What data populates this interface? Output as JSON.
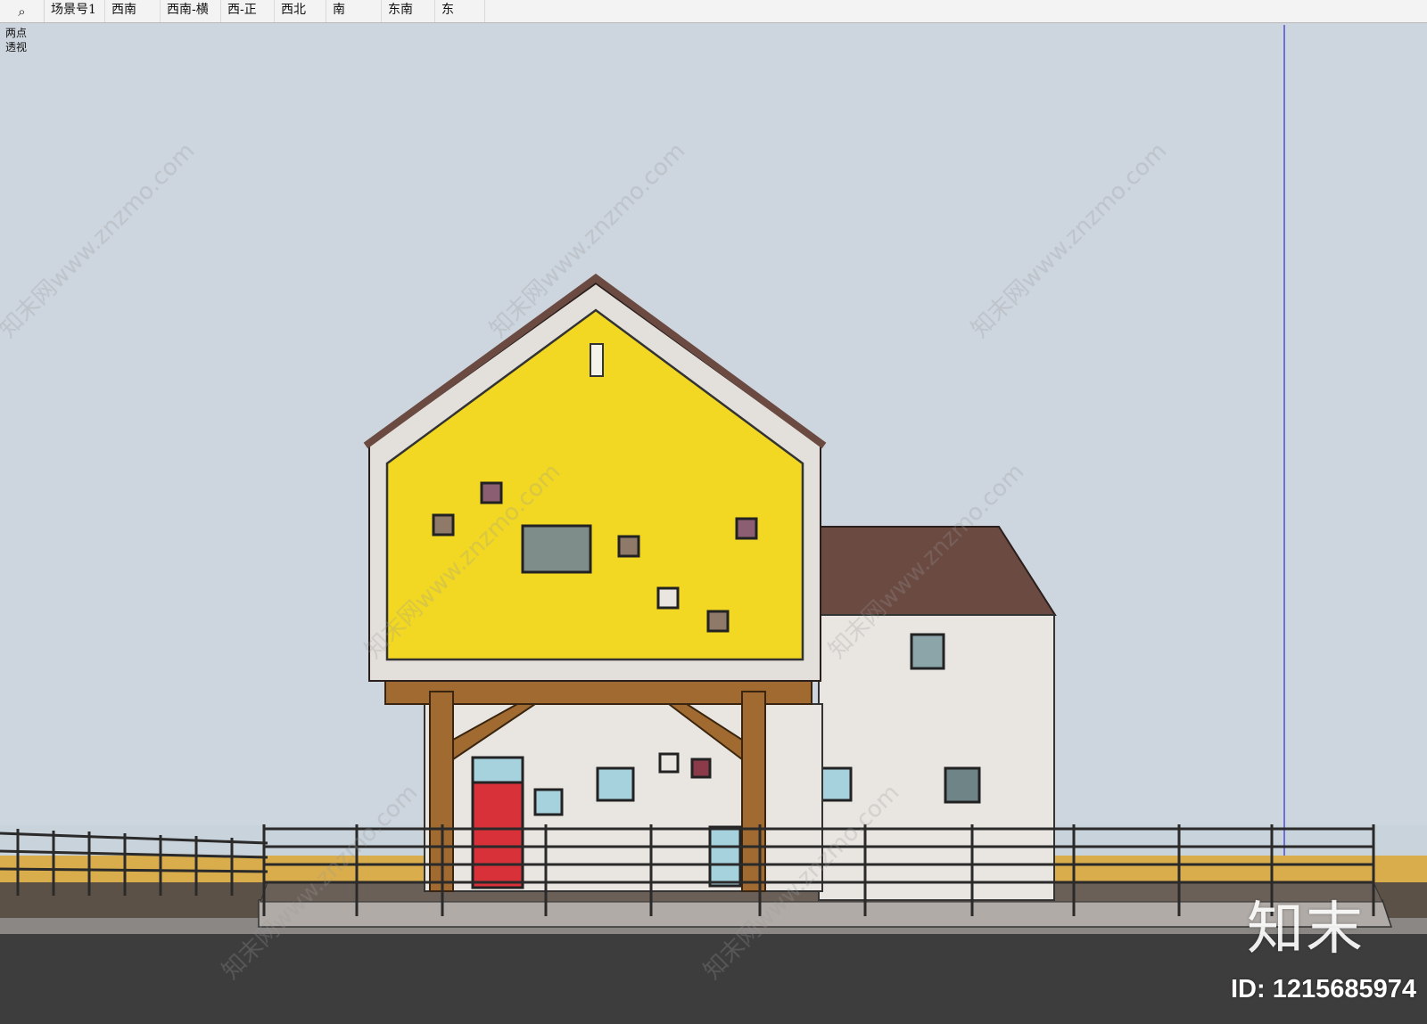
{
  "toolbar": {
    "search_icon": "search-icon",
    "scene_tabs": [
      "场景号1",
      "西南",
      "西南-横",
      "西-正",
      "西北",
      "南",
      "东南",
      "东"
    ]
  },
  "viewport": {
    "camera_mode": "两点透视",
    "colors": {
      "sky": "#c9d3dc",
      "gable_wall": "#f2d822",
      "roof": "#6b4a42",
      "wall": "#e9e6e1",
      "timber": "#a06a30",
      "door": "#d8313a",
      "ground": "#3e3d3d"
    }
  },
  "watermark": {
    "brand": "知末",
    "site": "知末网www.znzmo.com",
    "id_text": "ID: 1215685974"
  }
}
